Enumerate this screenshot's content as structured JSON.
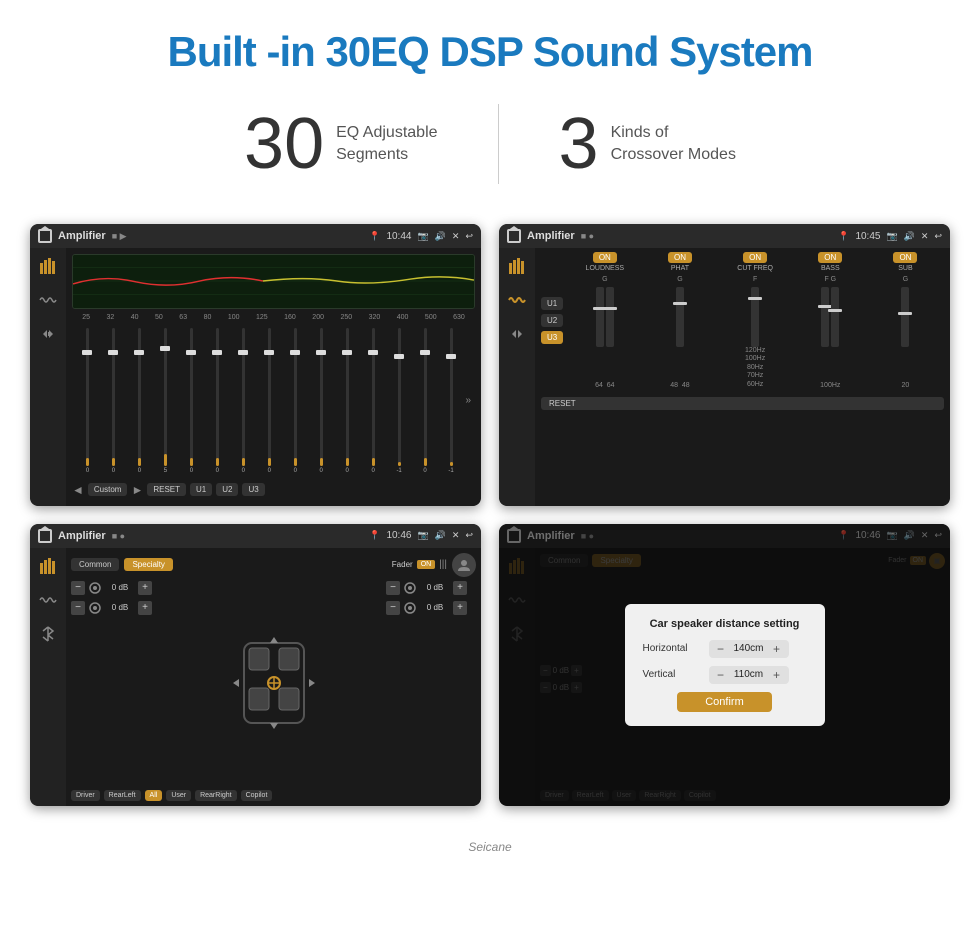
{
  "header": {
    "title": "Built -in 30EQ DSP Sound System"
  },
  "stats": {
    "eq_number": "30",
    "eq_label_line1": "EQ Adjustable",
    "eq_label_line2": "Segments",
    "crossover_number": "3",
    "crossover_label_line1": "Kinds of",
    "crossover_label_line2": "Crossover Modes"
  },
  "screen1": {
    "title": "Amplifier",
    "time": "10:44",
    "freq_labels": [
      "25",
      "32",
      "40",
      "50",
      "63",
      "80",
      "100",
      "125",
      "160",
      "200",
      "250",
      "320",
      "400",
      "500",
      "630"
    ],
    "sliders": [
      0,
      0,
      0,
      5,
      0,
      0,
      0,
      0,
      0,
      0,
      0,
      0,
      -1,
      0,
      -1
    ],
    "bottom_btns": [
      "Custom",
      "RESET",
      "U1",
      "U2",
      "U3"
    ]
  },
  "screen2": {
    "title": "Amplifier",
    "time": "10:45",
    "channels": [
      "LOUDNESS",
      "PHAT",
      "CUT FREQ",
      "BASS",
      "SUB"
    ],
    "toggles": [
      "ON",
      "ON",
      "ON",
      "ON",
      "ON"
    ],
    "presets": [
      "U1",
      "U2",
      "U3"
    ],
    "reset_label": "RESET"
  },
  "screen3": {
    "title": "Amplifier",
    "time": "10:46",
    "tabs": [
      "Common",
      "Specialty"
    ],
    "fader_label": "Fader",
    "fader_on": "ON",
    "db_values": [
      "0 dB",
      "0 dB",
      "0 dB",
      "0 dB"
    ],
    "zone_buttons": [
      "Driver",
      "RearLeft",
      "All",
      "User",
      "RearRight",
      "Copilot"
    ]
  },
  "screen4": {
    "title": "Amplifier",
    "time": "10:46",
    "dialog_title": "Car speaker distance setting",
    "horizontal_label": "Horizontal",
    "horizontal_value": "140cm",
    "vertical_label": "Vertical",
    "vertical_value": "110cm",
    "confirm_label": "Confirm",
    "tabs": [
      "Common",
      "Specialty"
    ],
    "db_values": [
      "0 dB",
      "0 dB"
    ]
  },
  "watermark": "Seicane"
}
